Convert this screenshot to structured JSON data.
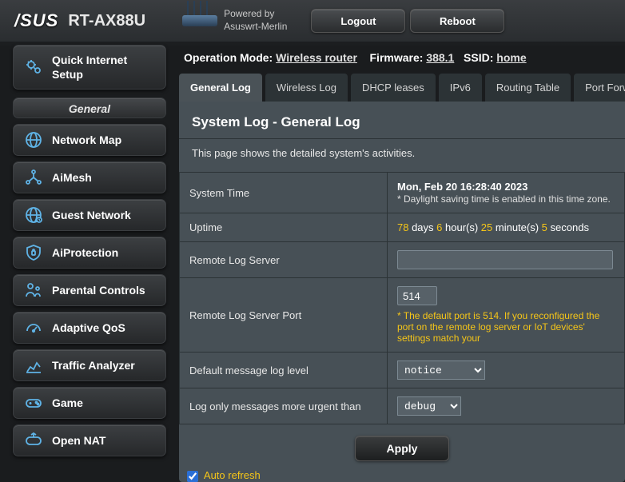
{
  "header": {
    "brand": "/SUS",
    "model": "RT-AX88U",
    "powered_by_line1": "Powered by",
    "powered_by_line2": "Asuswrt-Merlin",
    "logout": "Logout",
    "reboot": "Reboot"
  },
  "info": {
    "op_mode_label": "Operation Mode:",
    "op_mode_value": "Wireless router",
    "fw_label": "Firmware:",
    "fw_value": "388.1",
    "ssid_label": "SSID:",
    "ssid_value": "home"
  },
  "sidebar": {
    "quick": "Quick Internet Setup",
    "section": "General",
    "items": [
      {
        "label": "Network Map",
        "icon": "globe"
      },
      {
        "label": "AiMesh",
        "icon": "mesh"
      },
      {
        "label": "Guest Network",
        "icon": "guest"
      },
      {
        "label": "AiProtection",
        "icon": "shield"
      },
      {
        "label": "Parental Controls",
        "icon": "parental"
      },
      {
        "label": "Adaptive QoS",
        "icon": "gauge"
      },
      {
        "label": "Traffic Analyzer",
        "icon": "chart"
      },
      {
        "label": "Game",
        "icon": "gamepad"
      },
      {
        "label": "Open NAT",
        "icon": "nat"
      }
    ]
  },
  "tabs": [
    {
      "label": "General Log",
      "active": true
    },
    {
      "label": "Wireless Log"
    },
    {
      "label": "DHCP leases"
    },
    {
      "label": "IPv6"
    },
    {
      "label": "Routing Table"
    },
    {
      "label": "Port Forwarding"
    }
  ],
  "panel": {
    "title": "System Log - General Log",
    "desc": "This page shows the detailed system's activities.",
    "rows": {
      "system_time_label": "System Time",
      "system_time_value": "Mon, Feb 20 16:28:40 2023",
      "system_time_note": "* Daylight saving time is enabled in this time zone.",
      "uptime_label": "Uptime",
      "uptime_days": "78",
      "uptime_hours": "6",
      "uptime_minutes": "25",
      "uptime_seconds": "5",
      "uptime_days_unit": " days ",
      "uptime_hours_unit": " hour(s) ",
      "uptime_minutes_unit": " minute(s) ",
      "uptime_seconds_unit": " seconds",
      "remote_log_label": "Remote Log Server",
      "remote_log_value": "",
      "remote_port_label": "Remote Log Server Port",
      "remote_port_value": "514",
      "remote_port_note": "* The default port is 514. If you reconfigured the port on the remote log server or IoT devices' settings match your",
      "loglevel_label": "Default message log level",
      "loglevel_value": "notice",
      "urgent_label": "Log only messages more urgent than",
      "urgent_value": "debug"
    },
    "apply": "Apply",
    "auto_refresh": "Auto refresh"
  }
}
